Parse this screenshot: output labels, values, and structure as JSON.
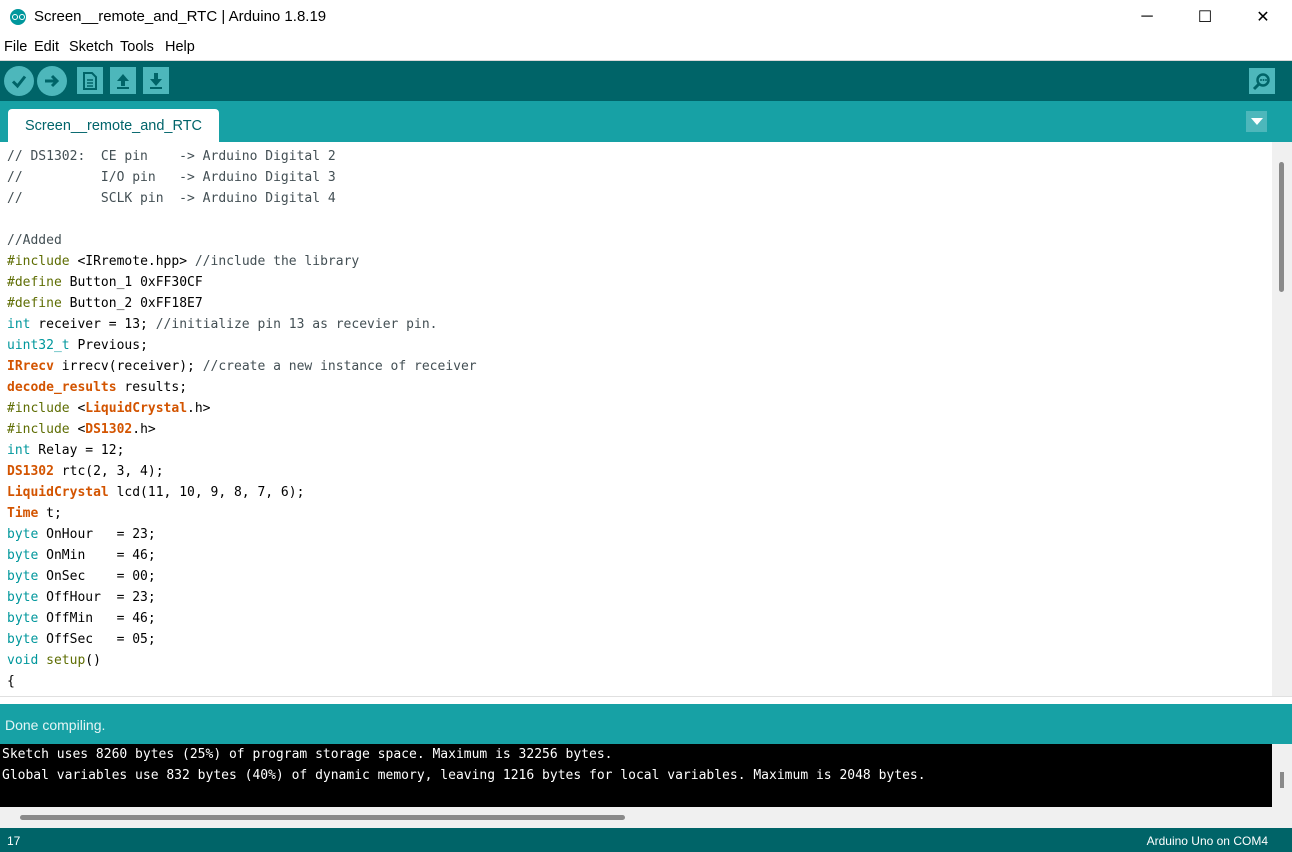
{
  "window": {
    "title": "Screen__remote_and_RTC | Arduino 1.8.19",
    "minimize_glyph": "─",
    "maximize_glyph": "☐",
    "close_glyph": "✕"
  },
  "menu": [
    "File",
    "Edit",
    "Sketch",
    "Tools",
    "Help"
  ],
  "toolbar": {
    "icons": [
      "verify-icon",
      "upload-icon",
      "new-icon",
      "open-icon",
      "save-icon",
      "serial-monitor-icon"
    ]
  },
  "tabs": [
    {
      "label": "Screen__remote_and_RTC"
    }
  ],
  "colors": {
    "toolbar": "#006468",
    "tabbar": "#17a1a5",
    "button": "#4db7bb",
    "comment": "#434f54",
    "directive": "#5e6d03",
    "type": "#00979c",
    "class": "#d35400"
  },
  "editor": {
    "lines": [
      [
        {
          "t": "comment",
          "v": "// DS1302:  CE pin    -> Arduino Digital 2"
        }
      ],
      [
        {
          "t": "comment",
          "v": "//          I/O pin   -> Arduino Digital 3"
        }
      ],
      [
        {
          "t": "comment",
          "v": "//          SCLK pin  -> Arduino Digital 4"
        }
      ],
      [
        {
          "t": "plain",
          "v": ""
        }
      ],
      [
        {
          "t": "comment",
          "v": "//Added"
        }
      ],
      [
        {
          "t": "directive",
          "v": "#include"
        },
        {
          "t": "plain",
          "v": " <IRremote.hpp> "
        },
        {
          "t": "comment",
          "v": "//include the library"
        }
      ],
      [
        {
          "t": "directive",
          "v": "#define"
        },
        {
          "t": "plain",
          "v": " Button_1 0xFF30CF"
        }
      ],
      [
        {
          "t": "directive",
          "v": "#define"
        },
        {
          "t": "plain",
          "v": " Button_2 0xFF18E7"
        }
      ],
      [
        {
          "t": "type",
          "v": "int"
        },
        {
          "t": "plain",
          "v": " receiver = 13; "
        },
        {
          "t": "comment",
          "v": "//initialize pin 13 as recevier pin."
        }
      ],
      [
        {
          "t": "type",
          "v": "uint32_t"
        },
        {
          "t": "plain",
          "v": " Previous;"
        }
      ],
      [
        {
          "t": "class",
          "v": "IRrecv"
        },
        {
          "t": "plain",
          "v": " irrecv(receiver); "
        },
        {
          "t": "comment",
          "v": "//create a new instance of receiver"
        }
      ],
      [
        {
          "t": "class",
          "v": "decode_results"
        },
        {
          "t": "plain",
          "v": " results;"
        }
      ],
      [
        {
          "t": "directive",
          "v": "#include"
        },
        {
          "t": "plain",
          "v": " <"
        },
        {
          "t": "class",
          "v": "LiquidCrystal"
        },
        {
          "t": "plain",
          "v": ".h>"
        }
      ],
      [
        {
          "t": "directive",
          "v": "#include"
        },
        {
          "t": "plain",
          "v": " <"
        },
        {
          "t": "class",
          "v": "DS1302"
        },
        {
          "t": "plain",
          "v": ".h>"
        }
      ],
      [
        {
          "t": "type",
          "v": "int"
        },
        {
          "t": "plain",
          "v": " Relay = 12;"
        }
      ],
      [
        {
          "t": "class",
          "v": "DS1302"
        },
        {
          "t": "plain",
          "v": " rtc(2, 3, 4);"
        }
      ],
      [
        {
          "t": "class",
          "v": "LiquidCrystal"
        },
        {
          "t": "plain",
          "v": " lcd(11, 10, 9, 8, 7, 6);"
        }
      ],
      [
        {
          "t": "class",
          "v": "Time"
        },
        {
          "t": "plain",
          "v": " t;"
        }
      ],
      [
        {
          "t": "type",
          "v": "byte"
        },
        {
          "t": "plain",
          "v": " OnHour   = 23;"
        }
      ],
      [
        {
          "t": "type",
          "v": "byte"
        },
        {
          "t": "plain",
          "v": " OnMin    = 46;"
        }
      ],
      [
        {
          "t": "type",
          "v": "byte"
        },
        {
          "t": "plain",
          "v": " OnSec    = 00;"
        }
      ],
      [
        {
          "t": "type",
          "v": "byte"
        },
        {
          "t": "plain",
          "v": " OffHour  = 23;"
        }
      ],
      [
        {
          "t": "type",
          "v": "byte"
        },
        {
          "t": "plain",
          "v": " OffMin   = 46;"
        }
      ],
      [
        {
          "t": "type",
          "v": "byte"
        },
        {
          "t": "plain",
          "v": " OffSec   = 05;"
        }
      ],
      [
        {
          "t": "type",
          "v": "void"
        },
        {
          "t": "plain",
          "v": " "
        },
        {
          "t": "directive",
          "v": "setup"
        },
        {
          "t": "plain",
          "v": "()"
        }
      ],
      [
        {
          "t": "plain",
          "v": "{"
        }
      ]
    ]
  },
  "status": {
    "text": "Done compiling."
  },
  "console": {
    "lines": [
      "Sketch uses 8260 bytes (25%) of program storage space. Maximum is 32256 bytes.",
      "Global variables use 832 bytes (40%) of dynamic memory, leaving 1216 bytes for local variables. Maximum is 2048 bytes."
    ]
  },
  "bottom": {
    "line_number": "17",
    "board": "Arduino Uno on COM4"
  }
}
